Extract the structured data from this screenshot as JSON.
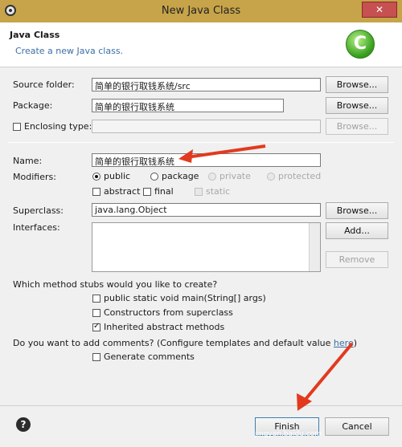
{
  "window": {
    "title": "New Java Class",
    "close_label": "✕"
  },
  "banner": {
    "heading": "Java Class",
    "description": "Create a new Java class.",
    "icon_letter": "C"
  },
  "source_folder": {
    "label": "Source folder:",
    "value": "简单的银行取钱系统/src",
    "browse": "Browse..."
  },
  "package": {
    "label": "Package:",
    "value": "简单的银行取钱系统",
    "browse": "Browse..."
  },
  "enclosing_type": {
    "label": "Enclosing type:",
    "value": "",
    "browse": "Browse..."
  },
  "name": {
    "label": "Name:",
    "value": "简单的银行取钱系统"
  },
  "modifiers": {
    "label": "Modifiers:",
    "public": "public",
    "package": "package",
    "private": "private",
    "protected": "protected",
    "abstract": "abstract",
    "final": "final",
    "static": "static"
  },
  "superclass": {
    "label": "Superclass:",
    "value": "java.lang.Object",
    "browse": "Browse..."
  },
  "interfaces": {
    "label": "Interfaces:",
    "add": "Add...",
    "remove": "Remove"
  },
  "stubs": {
    "question": "Which method stubs would you like to create?",
    "main": "public static void main(String[] args)",
    "constructors": "Constructors from superclass",
    "inherited": "Inherited abstract methods"
  },
  "comments": {
    "question": "Do you want to add comments? (Configure templates and default value ",
    "link": "here",
    "close_paren": ")",
    "generate": "Generate comments"
  },
  "footer": {
    "finish": "Finish",
    "cancel": "Cancel",
    "help_icon": "?"
  },
  "watermark": "jingyan.baidu.com",
  "colors": {
    "title_bar": "#c7a44a",
    "annotation_arrow": "#e23a1e",
    "link": "#3a6ea5"
  }
}
